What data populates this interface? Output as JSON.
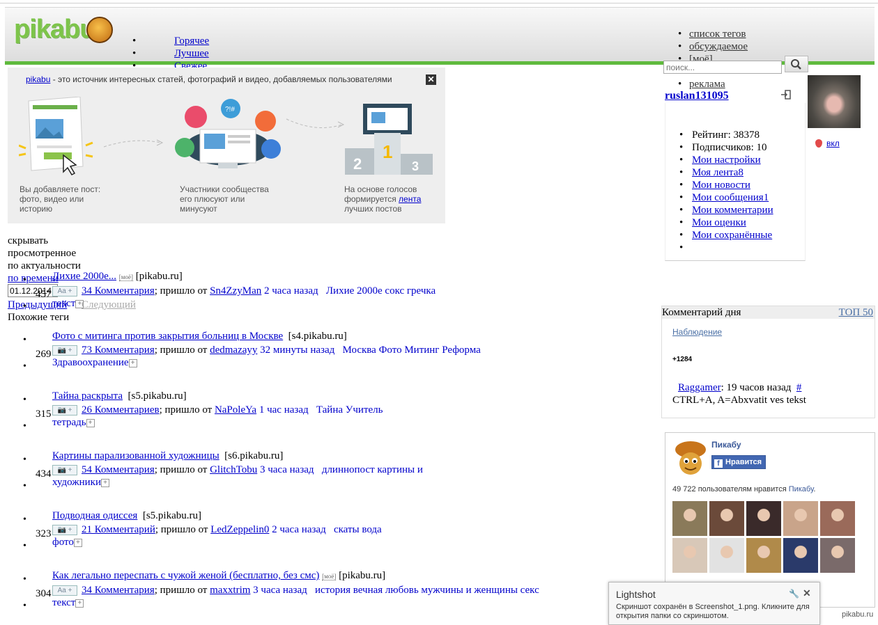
{
  "header": {
    "logo": "pikabu",
    "nav_main": [
      "Горячее",
      "Лучшее",
      "Свежее"
    ],
    "nav_right": [
      "список тегов",
      "обсуждаемое",
      "[моё]",
      "",
      "реклама"
    ],
    "search_placeholder": "поиск..."
  },
  "promo": {
    "site_link": "pikabu",
    "text": " - это источник интересных статей, фотографий и видео, добавляемых пользователями",
    "close": "✕",
    "step1": [
      "Вы добавляете пост:",
      "фото, видео или",
      "историю"
    ],
    "step2": [
      "Участники сообщества",
      "его плюсуют или",
      "минусуют"
    ],
    "step3_a": "На основе голосов",
    "step3_b": "формируется ",
    "step3_link": "лента",
    "step3_c": "лучших постов"
  },
  "filters": {
    "hide_1": "скрывать",
    "hide_2": "просмотренное",
    "sort_relevance": "по актуальности",
    "sort_time": "по времени",
    "date": "01.12.2014",
    "prev": "Предыдущий",
    "next": "Следующий",
    "similar_tags": "Похожие теги"
  },
  "posts": [
    {
      "title": "Лихие 2000е...",
      "moe": "[моё]",
      "domain": "[pikabu.ru]",
      "rating": "457",
      "badge": "Aa +",
      "comments": "34 Комментария",
      "from": "; пришло от ",
      "author": "Sn4ZzyMan",
      "time": "2 часа назад",
      "tags": "Лихие 2000е сокс гречка",
      "tags2": "текст"
    },
    {
      "title": "Фото с митинга против закрытия больниц в Москве",
      "moe": "",
      "domain": "[s4.pikabu.ru]",
      "rating": "269",
      "badge": "📷 +",
      "comments": "73 Комментария",
      "from": "; пришло от ",
      "author": "dedmazayy",
      "time": "32 минуты назад",
      "tags": "Москва Фото Митинг Реформа",
      "tags2": "Здравоохранение"
    },
    {
      "title": "Тайна раскрыта",
      "moe": "",
      "domain": "[s5.pikabu.ru]",
      "rating": "315",
      "badge": "📷 +",
      "comments": "26 Комментариев",
      "from": "; пришло от ",
      "author": "NaPoleYa",
      "time": "1 час назад",
      "tags": "Тайна Учитель",
      "tags2": "тетрадь"
    },
    {
      "title": "Картины парализованной художницы",
      "moe": "",
      "domain": "[s6.pikabu.ru]",
      "rating": "434",
      "badge": "📷 +",
      "comments": "54 Комментария",
      "from": "; пришло от ",
      "author": "GlitchTobu",
      "time": "3 часа назад",
      "tags": "длиннопост картины и",
      "tags2": "художники"
    },
    {
      "title": "Подводная одиссея",
      "moe": "",
      "domain": "[s5.pikabu.ru]",
      "rating": "323",
      "badge": "📷 +",
      "comments": "21 Комментарий",
      "from": "; пришло от ",
      "author": "LedZeppelin0",
      "time": "2 часа назад",
      "tags": "скаты вода",
      "tags2": "фото"
    },
    {
      "title": "Как легально переспать с чужой женой (бесплатно, без смс)",
      "moe": "[моё]",
      "domain": "[pikabu.ru]",
      "rating": "304",
      "badge": "Aa +",
      "comments": "34 Комментария",
      "from": "; пришло от ",
      "author": "maxxtrim",
      "time": "3 часа назад",
      "tags": "история вечная любовь мужчины и женщины секс",
      "tags2": "текст"
    }
  ],
  "profile": {
    "username": "ruslan131095",
    "vkl": "вкл",
    "rating": "Рейтинг: 38378",
    "subscribers": "Подписчиков: 10",
    "links": [
      "Мои настройки",
      "Моя лента8",
      "Мои новости",
      "Мои сообщения1",
      "Мои комментарии",
      "Мои оценки",
      "Мои сохранённые"
    ]
  },
  "comment_of_day": {
    "title": "Комментарий дня",
    "top": "ТОП 50",
    "post_link": "Наблюдение",
    "score": "+1284",
    "author": "Raggamer",
    "time": ": 19 часов назад",
    "hash": "#",
    "text": "CTRL+A, A=Abxvatit ves tekst"
  },
  "facebook": {
    "page_name": "Пикабу",
    "like": "Нравится",
    "count_text": "49 722 пользователям нравится ",
    "count_link": "Пикабу",
    "count_end": "."
  },
  "lightshot": {
    "title": "Lightshot",
    "text1": "Скриншот сохранён в Screenshot_1.png. Кликните для",
    "text2": "открытия папки со скриншотом."
  },
  "watermark": "pikabu.ru",
  "colors": {
    "green": "#5fba3d",
    "link": "#0000cc",
    "fb_blue": "#3b5998"
  }
}
